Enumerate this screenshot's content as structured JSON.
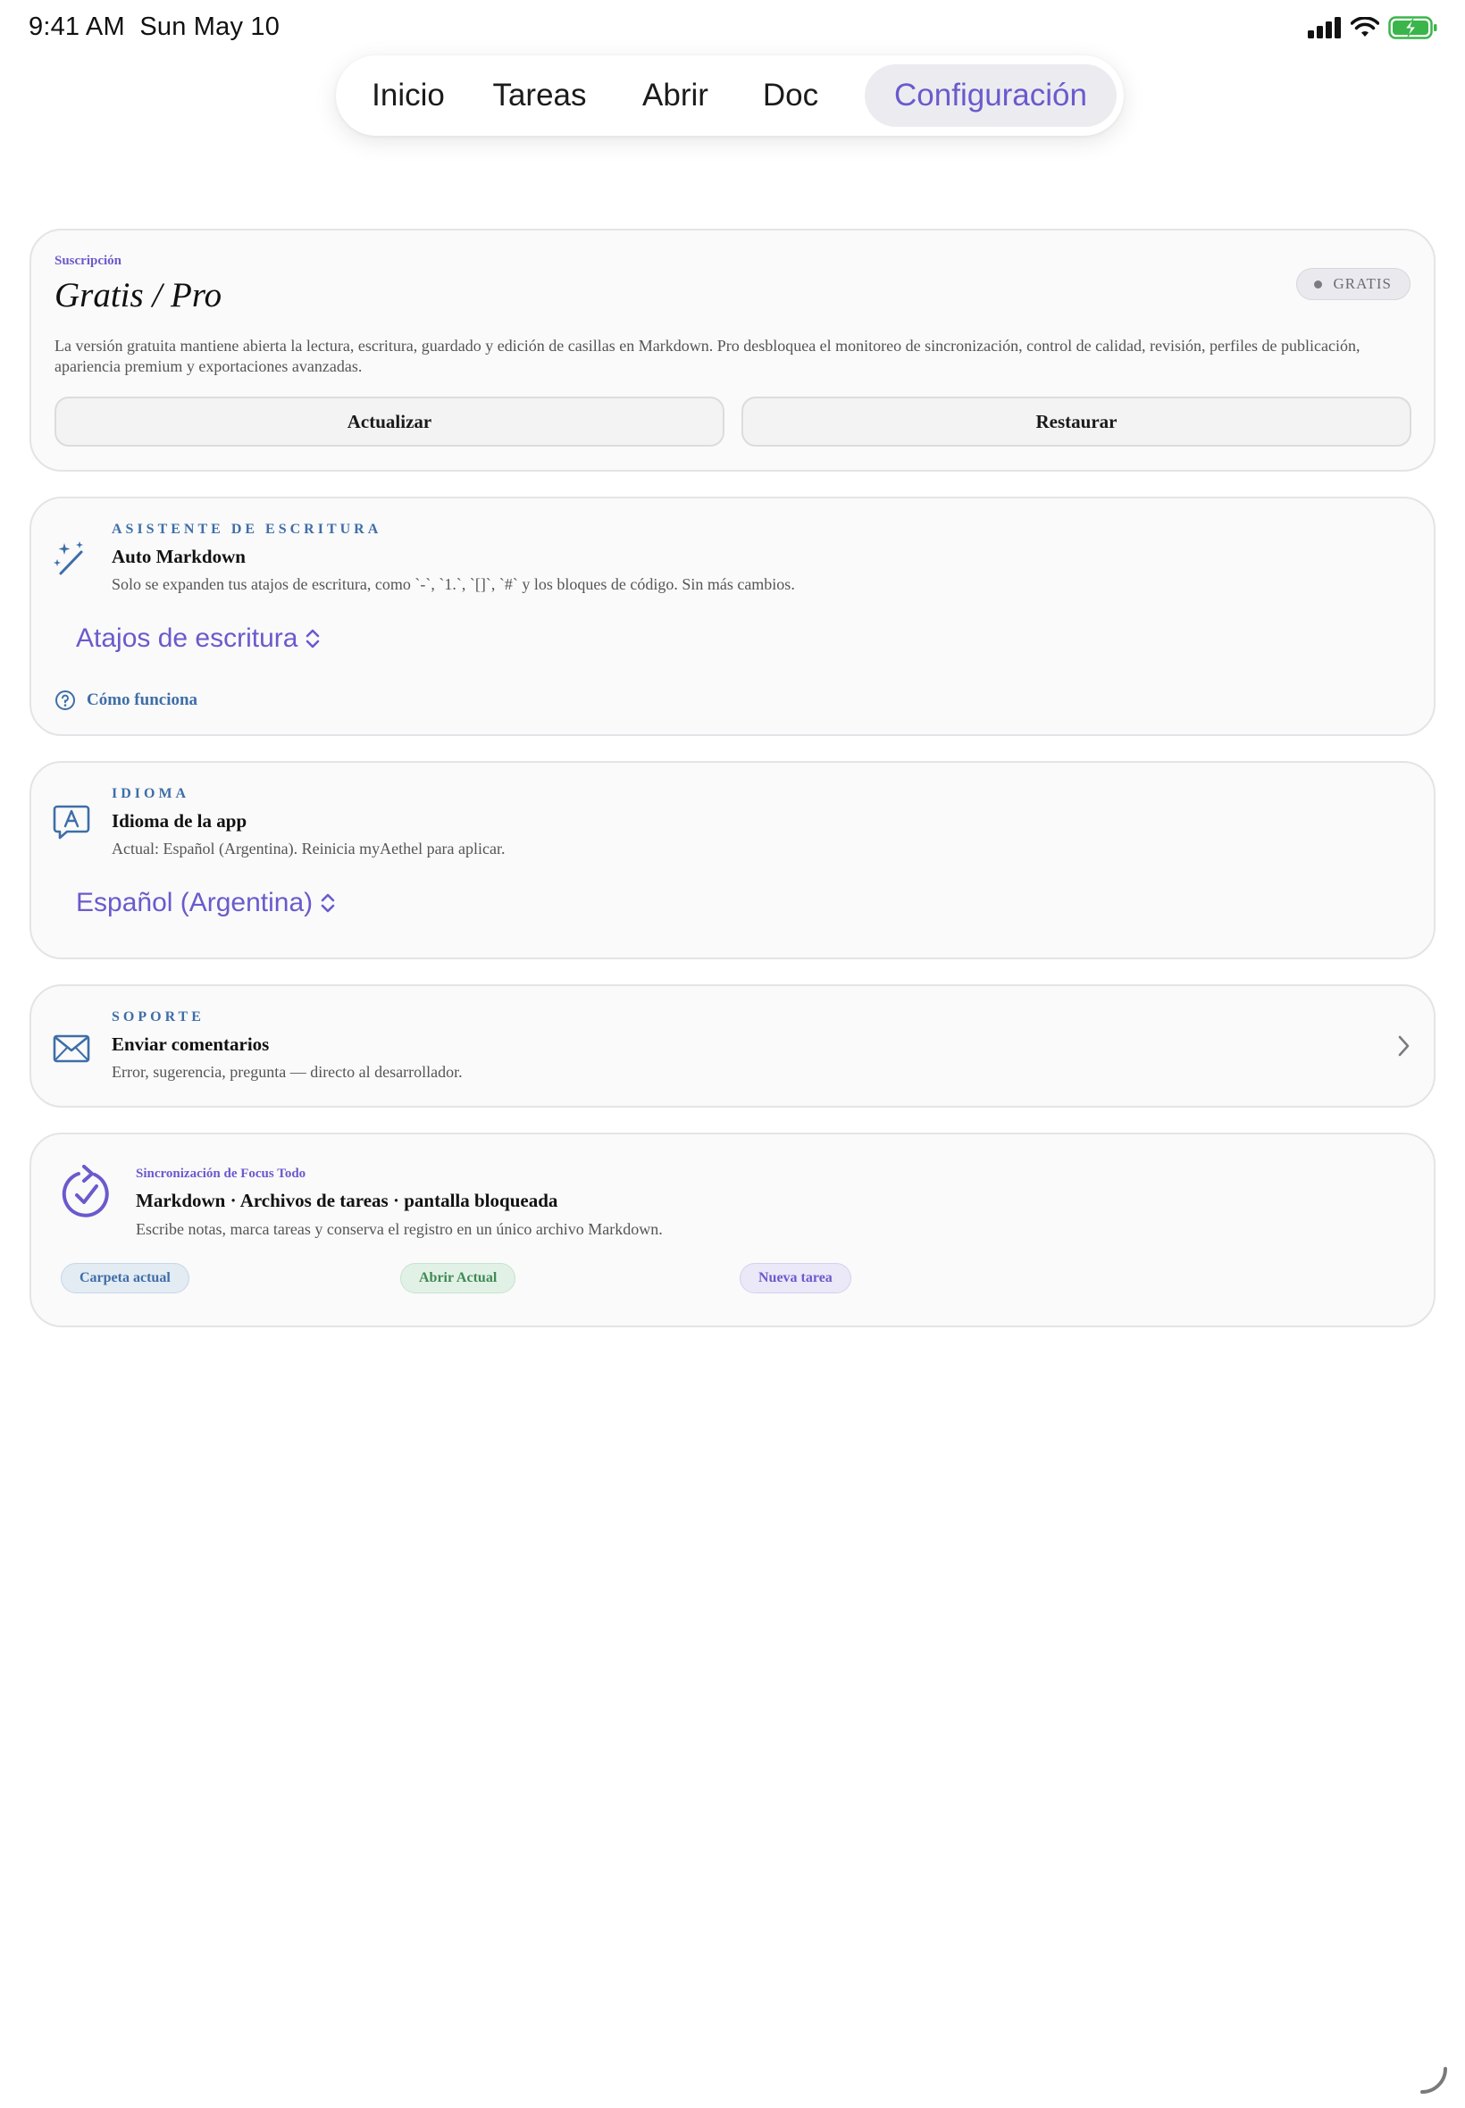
{
  "status_bar": {
    "time": "9:41 AM",
    "date": "Sun May 10",
    "icons": [
      "signal-icon",
      "wifi-icon",
      "battery-charging-icon"
    ]
  },
  "tabs": [
    {
      "label": "Inicio",
      "active": false
    },
    {
      "label": "Tareas",
      "active": false
    },
    {
      "label": "Abrir",
      "active": false
    },
    {
      "label": "Doc",
      "active": false
    },
    {
      "label": "Configuración",
      "active": true
    }
  ],
  "subscription": {
    "eyebrow": "Suscripción",
    "title": "Gratis / Pro",
    "badge": "GRATIS",
    "description": "La versión gratuita mantiene abierta la lectura, escritura, guardado y edición de casillas en Markdown. Pro desbloquea el monitoreo de sincronización, control de calidad, revisión, perfiles de publicación, apariencia premium y exportaciones avanzadas.",
    "upgrade_label": "Actualizar",
    "restore_label": "Restaurar"
  },
  "writing_assistant": {
    "eyebrow": "ASISTENTE DE ESCRITURA",
    "title": "Auto Markdown",
    "description": "Solo se expanden tus atajos de escritura, como `-`, `1.`, `[]`, `#` y los bloques de código. Sin más cambios.",
    "picker_value": "Atajos de escritura",
    "help_link": "Cómo funciona",
    "icon": "magic-wand-icon"
  },
  "language": {
    "eyebrow": "IDIOMA",
    "title": "Idioma de la app",
    "description": "Actual: Español (Argentina). Reinicia myAethel para aplicar.",
    "picker_value": "Español (Argentina)",
    "icon": "language-bubble-icon"
  },
  "support": {
    "eyebrow": "SOPORTE",
    "title": "Enviar comentarios",
    "description": "Error, sugerencia, pregunta — directo al desarrollador.",
    "icon": "envelope-icon"
  },
  "sync": {
    "eyebrow": "Sincronización de Focus Todo",
    "title": "Markdown · Archivos de tareas · pantalla bloqueada",
    "description": "Escribe notas, marca tareas y conserva el registro en un único archivo Markdown.",
    "chips": [
      {
        "label": "Carpeta actual",
        "color": "#3e6ea8",
        "bg": "#e3ebf3"
      },
      {
        "label": "Abrir Actual",
        "color": "#3f8a55",
        "bg": "#e2f1e6"
      },
      {
        "label": "Nueva tarea",
        "color": "#6a5acd",
        "bg": "#ebe8f7"
      }
    ],
    "icon": "sync-check-icon"
  },
  "colors": {
    "accent": "#6a5acd",
    "section_blue": "#3e6ea8"
  }
}
